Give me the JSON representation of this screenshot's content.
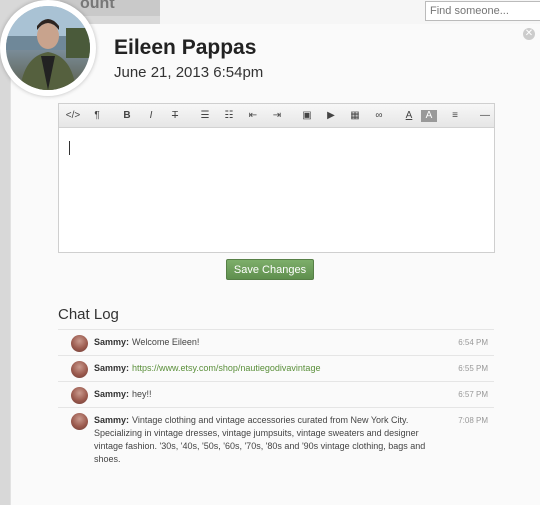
{
  "background": {
    "tab_label": "ount"
  },
  "search": {
    "placeholder": "Find someone..."
  },
  "profile": {
    "name": "Eileen Pappas",
    "date": "June 21, 2013 6:54pm"
  },
  "editor": {
    "toolbar": [
      {
        "name": "html-icon",
        "glyph": "</>"
      },
      {
        "name": "paragraph-icon",
        "glyph": "¶"
      },
      {
        "name": "sep"
      },
      {
        "name": "bold-icon",
        "glyph": "B"
      },
      {
        "name": "italic-icon",
        "glyph": "I"
      },
      {
        "name": "strikethrough-icon",
        "glyph": "T"
      },
      {
        "name": "sep"
      },
      {
        "name": "unordered-list-icon",
        "glyph": "☰"
      },
      {
        "name": "ordered-list-icon",
        "glyph": "☷"
      },
      {
        "name": "outdent-icon",
        "glyph": "⇤"
      },
      {
        "name": "indent-icon",
        "glyph": "⇥"
      },
      {
        "name": "sep"
      },
      {
        "name": "image-icon",
        "glyph": "▣"
      },
      {
        "name": "video-icon",
        "glyph": "▶"
      },
      {
        "name": "table-icon",
        "glyph": "▦"
      },
      {
        "name": "link-icon",
        "glyph": "∞"
      },
      {
        "name": "sep"
      },
      {
        "name": "font-color-icon",
        "glyph": "A"
      },
      {
        "name": "background-color-icon",
        "glyph": "A"
      },
      {
        "name": "sep"
      },
      {
        "name": "align-icon",
        "glyph": "≡"
      },
      {
        "name": "sep"
      },
      {
        "name": "horizontal-rule-icon",
        "glyph": "—"
      }
    ],
    "save_label": "Save Changes"
  },
  "chat": {
    "title": "Chat Log",
    "messages": [
      {
        "sender": "Sammy:",
        "text": "Welcome Eileen!",
        "link": "",
        "time": "6:54 PM"
      },
      {
        "sender": "Sammy:",
        "text": "",
        "link": "https://www.etsy.com/shop/nautiegodivavintage",
        "time": "6:55 PM"
      },
      {
        "sender": "Sammy:",
        "text": "hey!!",
        "link": "",
        "time": "6:57 PM"
      },
      {
        "sender": "Sammy:",
        "text": "Vintage clothing and vintage accessories curated from New York City. Specializing in vintage dresses, vintage jumpsuits, vintage sweaters and designer vintage fashion. '30s, '40s, '50s, '60s, '70s, '80s and '90s vintage clothing, bags and shoes.",
        "link": "",
        "time": "7:08 PM"
      }
    ]
  },
  "colors": {
    "save_green": "#6a9a57",
    "link_green": "#5a8f3a"
  }
}
